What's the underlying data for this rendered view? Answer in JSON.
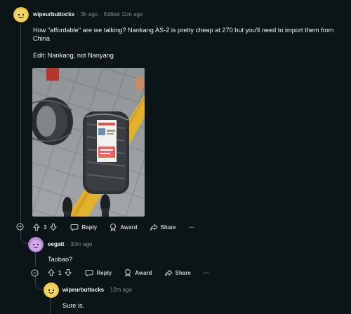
{
  "comment1": {
    "username": "wipeurbuttocks",
    "time": "3h ago",
    "edited": "Edited 11m ago",
    "body": "How \"affordable\" are we talking? Nankang AS-2 is pretty cheap at 270 but you'll need to import them from China",
    "edit_note": "Edit: Nankang, not Nanyang",
    "score": "3",
    "reply_label": "Reply",
    "award_label": "Award",
    "share_label": "Share",
    "more_label": "···"
  },
  "comment2": {
    "username": "eegatt",
    "time": "30m ago",
    "body": "Taobao?",
    "score": "1",
    "reply_label": "Reply",
    "award_label": "Award",
    "share_label": "Share",
    "more_label": "···"
  },
  "comment3": {
    "username": "wipeurbuttocks",
    "time": "12m ago",
    "body": "Sure is."
  },
  "colors": {
    "background": "#0b1416",
    "thread_line": "#33464c",
    "text": "#f2f4f5",
    "meta": "#82959b"
  },
  "icons": [
    "snoo-avatar-icon",
    "upvote-icon",
    "downvote-icon",
    "reply-icon",
    "award-icon",
    "share-icon",
    "collapse-icon"
  ]
}
